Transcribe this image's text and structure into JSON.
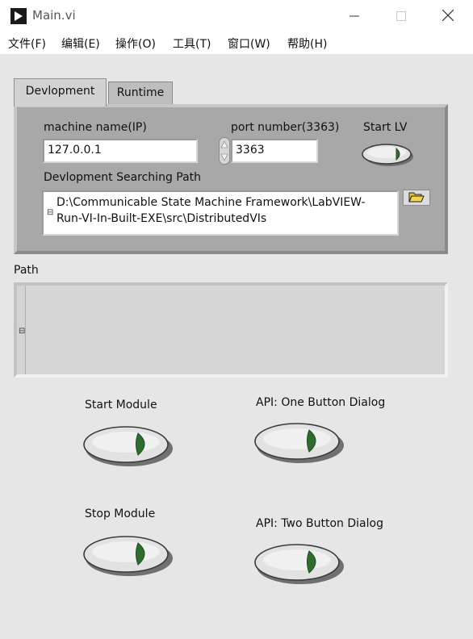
{
  "window": {
    "title": "Main.vi",
    "minimize_icon": "minimize-icon",
    "maximize_icon": "maximize-icon",
    "close_icon": "close-icon"
  },
  "menu": [
    {
      "label": "文件(F)"
    },
    {
      "label": "编辑(E)"
    },
    {
      "label": "操作(O)"
    },
    {
      "label": "工具(T)"
    },
    {
      "label": "窗口(W)"
    },
    {
      "label": "帮助(H)"
    }
  ],
  "tabs": [
    {
      "label": "Devlopment",
      "selected": true
    },
    {
      "label": "Runtime",
      "selected": false
    }
  ],
  "development": {
    "machine_label": "machine name(IP)",
    "machine_value": "127.0.0.1",
    "port_label": "port number(3363)",
    "port_value": "3363",
    "start_lv_label": "Start LV",
    "search_path_label": "Devlopment Searching Path",
    "search_path_value": "D:\\Communicable State Machine Framework\\LabVIEW-\nRun-VI-In-Built-EXE\\src\\DistributedVIs",
    "browse_icon": "folder-open-icon"
  },
  "path": {
    "label": "Path",
    "value": ""
  },
  "buttons": {
    "start_module": "Start Module",
    "stop_module": "Stop Module",
    "api_one": "API: One Button Dialog",
    "api_two": "API: Two Button Dialog"
  },
  "colors": {
    "panel_bg": "#e6e6e6",
    "tab_panel": "#a8a8a8",
    "led_green": "#2f6d2f",
    "button_face": "#e2e2e2"
  }
}
